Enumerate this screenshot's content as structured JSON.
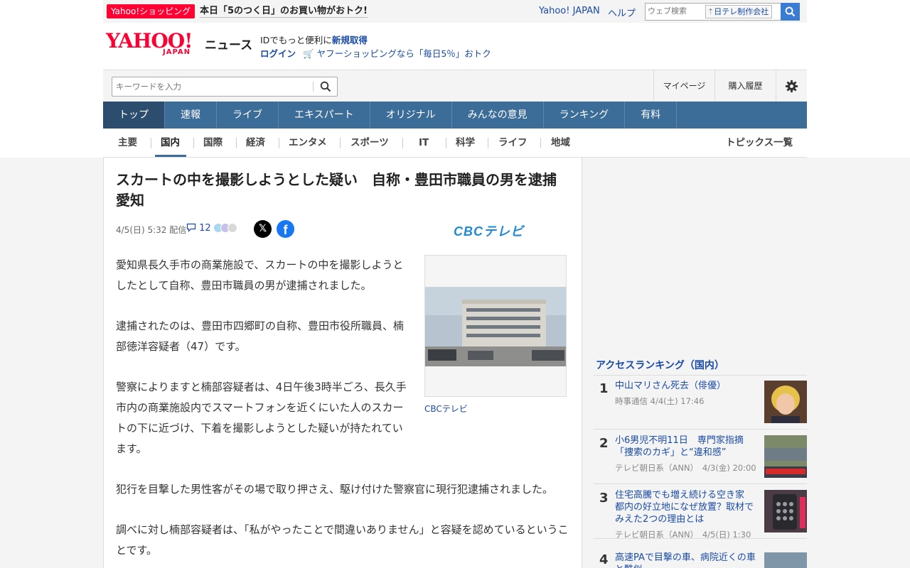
{
  "promo": {
    "badge": "Yahoo!ショッピング",
    "text": "本日「5のつく日」のお買い物がおトク!"
  },
  "top_links": {
    "yahoo_japan": "Yahoo! JAPAN",
    "help": "ヘルプ"
  },
  "web_search": {
    "placeholder": "ウェブ検索",
    "chip": "日テレ制作会社"
  },
  "logo": {
    "brand": "YAHOO!",
    "sub": "JAPAN",
    "section": "ニュース"
  },
  "login_box": {
    "line1_prefix": "IDでもっと便利に",
    "line1_link": "新規取得",
    "login": "ログイン",
    "shopping_promo": "ヤフーショッピングなら「毎日5％」おトク"
  },
  "search": {
    "placeholder": "キーワードを入力"
  },
  "utility": {
    "mypage": "マイページ",
    "history": "購入履歴"
  },
  "main_nav": [
    "トップ",
    "速報",
    "ライブ",
    "エキスパート",
    "オリジナル",
    "みんなの意見",
    "ランキング",
    "有料"
  ],
  "sub_nav": [
    "主要",
    "国内",
    "国際",
    "経済",
    "エンタメ",
    "スポーツ",
    "IT",
    "科学",
    "ライフ",
    "地域"
  ],
  "sub_nav_right": "トピックス一覧",
  "article": {
    "headline": "スカートの中を撮影しようとした疑い　自称・豊田市職員の男を逮捕　愛知",
    "date": "4/5(日) 5:32 配信",
    "comments": "12",
    "source_logo": "CBCテレビ",
    "photo_caption": "CBCテレビ",
    "paragraphs": [
      "愛知県長久手市の商業施設で、スカートの中を撮影しようとしたとして自称、豊田市職員の男が逮捕されました。",
      "逮捕されたのは、豊田市四郷町の自称、豊田市役所職員、楠部徳洋容疑者（47）です。",
      "警察によりますと楠部容疑者は、4日午後3時半ごろ、長久手市内の商業施設内でスマートフォンを近くにいた人のスカートの下に近づけ、下着を撮影しようとした疑いが持たれています。",
      "犯行を目撃した男性客がその場で取り押さえ、駆け付けた警察官に現行犯逮捕されました。",
      "調べに対し楠部容疑者は、「私がやったことで間違いありません」と容疑を認めているということです。"
    ]
  },
  "ranking": {
    "title": "アクセスランキング（国内）",
    "items": [
      {
        "rank": "1",
        "title": "中山マリさん死去（俳優）",
        "source": "時事通信 4/4(土) 17:46"
      },
      {
        "rank": "2",
        "title": "小6男児不明11日　専門家指摘「捜索のカギ」と“違和感”",
        "source": "テレビ朝日系（ANN）　4/3(金) 20:00"
      },
      {
        "rank": "3",
        "title": "住宅高騰でも増え続ける空き家　都内の好立地になぜ放置？取材でみえた2つの理由とは",
        "source": "テレビ朝日系（ANN）　4/5(日) 1:30"
      },
      {
        "rank": "4",
        "title": "高速PAで目撃の車、病院近くの車と酷似",
        "source": ""
      }
    ]
  }
}
